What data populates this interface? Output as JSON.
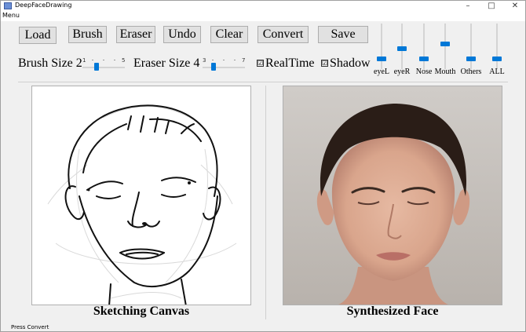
{
  "window": {
    "title": "DeepFaceDrawing",
    "min_glyph": "–",
    "max_glyph": "□",
    "close_glyph": "✕"
  },
  "menu": {
    "label": "Menu"
  },
  "toolbar": {
    "load": "Load",
    "brush": "Brush",
    "eraser": "Eraser",
    "undo": "Undo",
    "clear": "Clear",
    "convert": "Convert",
    "save": "Save"
  },
  "brush_size": {
    "label": "Brush Size 2",
    "min": "1",
    "max": "5",
    "value": 2
  },
  "eraser_size": {
    "label": "Eraser Size 4",
    "min": "3",
    "max": "7",
    "value": 4
  },
  "options": {
    "realtime": "RealTime",
    "realtime_checked": true,
    "shadow": "Shadow",
    "shadow_checked": true,
    "check_glyph": "☑"
  },
  "feature_sliders": [
    {
      "label": "eyeL",
      "value": 0.2
    },
    {
      "label": "eyeR",
      "value": 0.45
    },
    {
      "label": "Nose",
      "value": 0.2
    },
    {
      "label": "Mouth",
      "value": 0.55
    },
    {
      "label": "Others",
      "value": 0.2
    },
    {
      "label": "ALL",
      "value": 0.2
    }
  ],
  "captions": {
    "sketch": "Sketching Canvas",
    "face": "Synthesized Face"
  },
  "status": "Press Convert",
  "colors": {
    "accent": "#0078d7",
    "button_bg": "#e1e1e1",
    "window_bg": "#f0f0f0"
  }
}
